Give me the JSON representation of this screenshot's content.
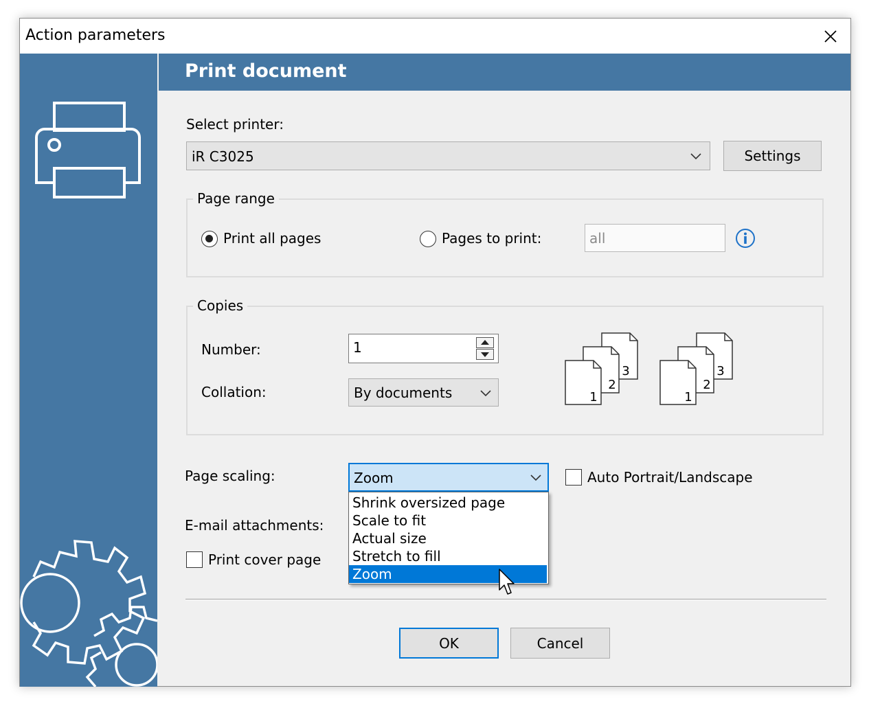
{
  "window": {
    "title": "Action parameters"
  },
  "header": {
    "title": "Print document"
  },
  "printer": {
    "label": "Select printer:",
    "value": "iR C3025",
    "settings_label": "Settings"
  },
  "page_range": {
    "legend": "Page range",
    "print_all_label": "Print all pages",
    "print_all_selected": true,
    "pages_to_print_label": "Pages to print:",
    "pages_to_print_selected": false,
    "pages_value": "all"
  },
  "copies": {
    "legend": "Copies",
    "number_label": "Number:",
    "number_value": "1",
    "collation_label": "Collation:",
    "collation_value": "By documents",
    "page_numbers": [
      "1",
      "2",
      "3"
    ]
  },
  "scaling": {
    "label": "Page scaling:",
    "value": "Zoom",
    "options": [
      "Shrink oversized page",
      "Scale to fit",
      "Actual size",
      "Stretch to fill",
      "Zoom"
    ],
    "highlighted_index": 4,
    "auto_orientation_label": "Auto Portrait/Landscape",
    "auto_orientation_checked": false
  },
  "email": {
    "label": "E-mail attachments:"
  },
  "cover": {
    "label": "Print cover page",
    "checked": false
  },
  "footer": {
    "ok_label": "OK",
    "cancel_label": "Cancel"
  },
  "colors": {
    "accent": "#4577a3",
    "highlight": "#0078d7",
    "combo_focus": "#cce4f7"
  },
  "icons": [
    "close-icon",
    "printer-icon",
    "gears-icon",
    "chevron-down-icon",
    "info-icon",
    "collate-icon",
    "cursor-icon"
  ]
}
